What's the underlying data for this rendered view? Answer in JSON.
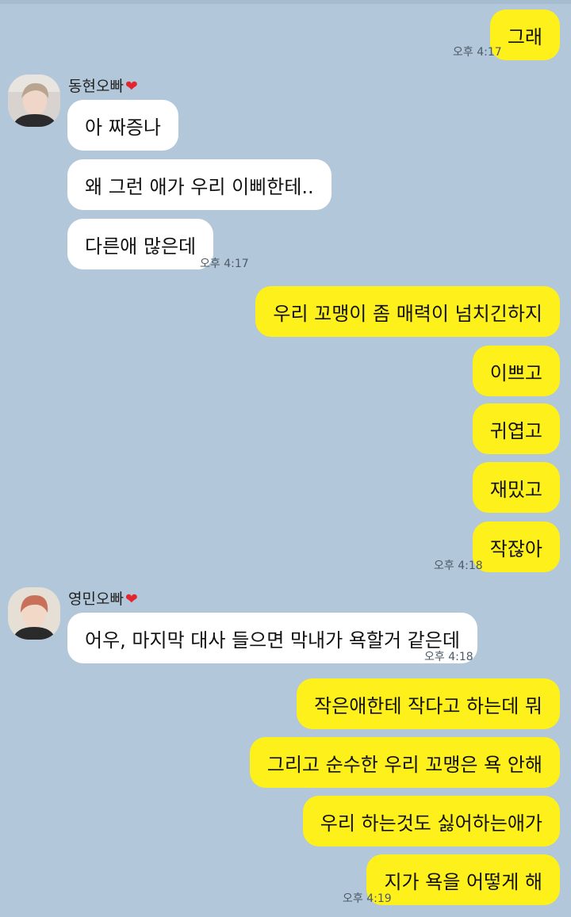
{
  "messages": {
    "m1": {
      "text": "그래",
      "time": "오후 4:17"
    },
    "m2": {
      "text": "아 짜증나"
    },
    "m3": {
      "text": "왜 그런 애가 우리 이삐한테.."
    },
    "m4": {
      "text": "다른애 많은데",
      "time": "오후 4:17"
    },
    "m5": {
      "text": "우리 꼬맹이 좀 매력이 넘치긴하지"
    },
    "m6": {
      "text": "이쁘고"
    },
    "m7": {
      "text": "귀엽고"
    },
    "m8": {
      "text": "재밌고"
    },
    "m9": {
      "text": "작잖아",
      "time": "오후 4:18"
    },
    "m10": {
      "text": "어우, 마지막 대사 들으면 막내가 욕할거 같은데",
      "time": "오후 4:18"
    },
    "m11": {
      "text": "작은애한테 작다고 하는데 뭐"
    },
    "m12": {
      "text": "그리고 순수한 우리 꼬맹은 욕 안해"
    },
    "m13": {
      "text": "우리 하는것도 싫어하는애가"
    },
    "m14": {
      "text": "지가 욕을 어떻게 해",
      "time": "오후 4:19"
    }
  },
  "senders": {
    "s1": {
      "name": "동현오빠",
      "heart": "❤"
    },
    "s2": {
      "name": "영민오빠",
      "heart": "❤"
    }
  },
  "colors": {
    "background": "#b2c7d9",
    "my_bubble": "#fef01b",
    "their_bubble": "#ffffff"
  }
}
